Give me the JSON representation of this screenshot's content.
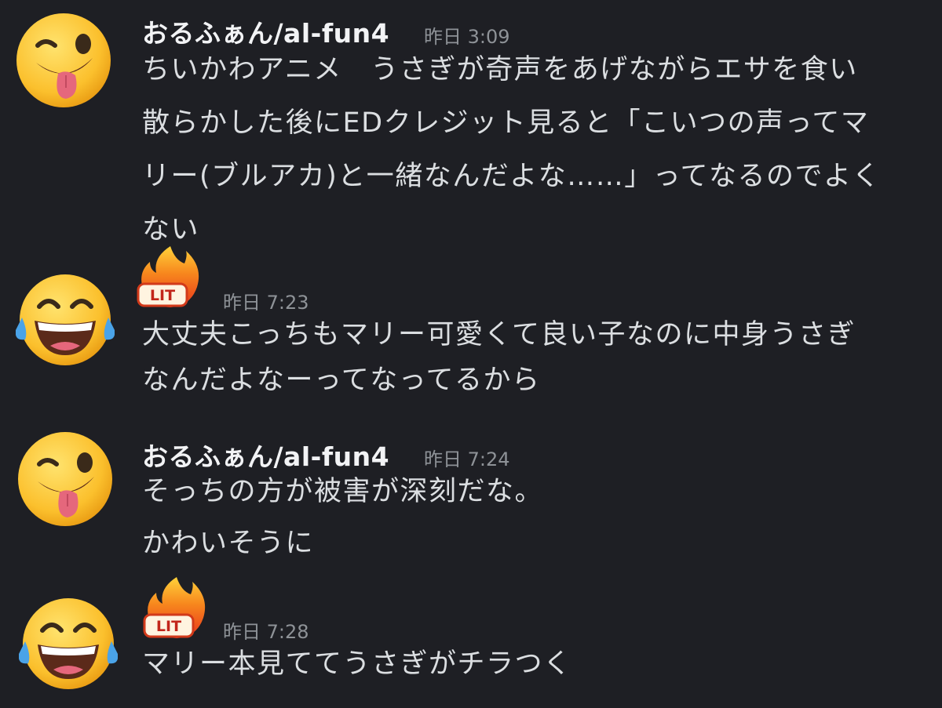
{
  "messages": [
    {
      "username": "おるふぁん/al-fun4",
      "timestamp": "昨日 3:09",
      "avatar": "winking-tongue-emoji",
      "badge": "",
      "lines": [
        "ちいかわアニメ　うさぎが奇声をあげながらエサを食い",
        "散らかした後にEDクレジット見ると「こいつの声ってマ",
        "リー(ブルアカ)と一緒なんだよな……」ってなるのでよく",
        "ない"
      ]
    },
    {
      "username": "",
      "timestamp": "昨日 7:23",
      "avatar": "tears-of-joy-emoji",
      "badge": "LIT",
      "lines": [
        "大丈夫こっちもマリー可愛くて良い子なのに中身うさぎ",
        "なんだよなーってなってるから"
      ]
    },
    {
      "username": "おるふぁん/al-fun4",
      "timestamp": "昨日 7:24",
      "avatar": "winking-tongue-emoji",
      "badge": "",
      "lines": [
        "そっちの方が被害が深刻だな。",
        "かわいそうに"
      ]
    },
    {
      "username": "",
      "timestamp": "昨日 7:28",
      "avatar": "tears-of-joy-emoji",
      "badge": "LIT",
      "lines": [
        "マリー本見ててうさぎがチラつく"
      ]
    }
  ],
  "colors": {
    "background": "#1e1f24",
    "text": "#dbdee1",
    "username": "#f2f3f5",
    "timestamp": "#8e9297",
    "emoji_yellow": "#fbc02d"
  }
}
